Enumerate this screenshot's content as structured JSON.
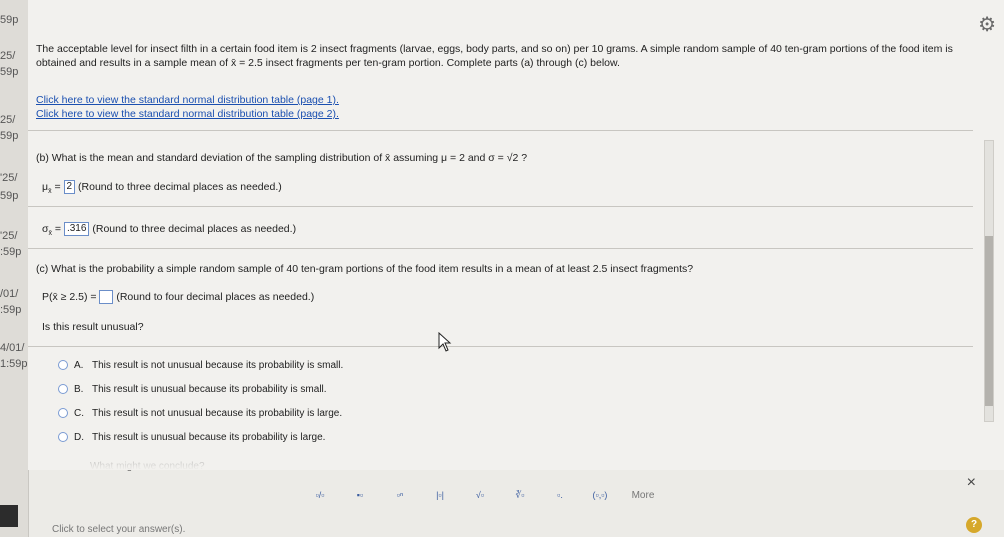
{
  "gutter": {
    "labels": [
      "59p",
      "25/",
      "59p",
      "25/",
      "59p",
      "'25/",
      "59p",
      "'25/",
      ":59p",
      "/01/",
      ":59p",
      "4/01/",
      "1:59p"
    ]
  },
  "problem": {
    "text_part1": "The acceptable level for insect filth in a certain food item is 2 insect fragments (larvae, eggs, body parts, and so on) per 10 grams. A simple random sample of 40 ten-gram portions of the food item is obtained and results in a sample mean of ",
    "xbar": "x̄",
    "text_part2": " = 2.5 insect fragments per ten-gram portion. Complete parts (a) through (c) below."
  },
  "links": {
    "table_page1": "Click here to view the standard normal distribution table (page 1).",
    "table_page2": "Click here to view the standard normal distribution table (page 2)."
  },
  "part_b": {
    "question": "(b) What is the mean and standard deviation of the sampling distribution of x̄ assuming μ = 2 and σ = √2 ?",
    "mu_label": "μ",
    "mu_sub": "x̄",
    "mu_value": "2",
    "mu_hint": "(Round to three decimal places as needed.)",
    "sigma_label": "σ",
    "sigma_sub": "x̄",
    "sigma_value": ".316",
    "sigma_hint": "(Round to three decimal places as needed.)"
  },
  "part_c": {
    "question": "(c) What is the probability a simple random sample of 40 ten-gram portions of the food item results in a mean of at least 2.5 insect fragments?",
    "prob_label": "P(x̄ ≥ 2.5) =",
    "prob_hint": "(Round to four decimal places as needed.)",
    "unusual_question": "Is this result unusual?",
    "choices": [
      {
        "letter": "A.",
        "text": "This result is not unusual because its probability is small."
      },
      {
        "letter": "B.",
        "text": "This result is unusual because its probability is small."
      },
      {
        "letter": "C.",
        "text": "This result is not unusual because its probability is large."
      },
      {
        "letter": "D.",
        "text": "This result is unusual because its probability is large."
      }
    ],
    "faded_text": "What might we conclude?"
  },
  "toolbar": {
    "tools": [
      "▫/▫",
      "▪▫",
      "▫ⁿ",
      "|▫|",
      "√▫",
      "∛▫",
      "▫.",
      "(▫,▫)"
    ],
    "more": "More"
  },
  "footer": {
    "hint": "Click to select your answer(s).",
    "help": "?",
    "close": "×"
  }
}
